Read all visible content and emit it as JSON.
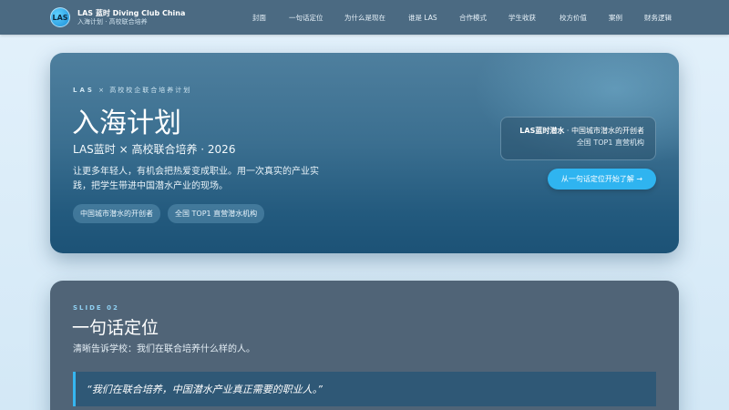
{
  "header": {
    "logo_text": "LAS",
    "brand_name": "LAS 蓝时 Diving Club China",
    "brand_sub": "入海计划 · 高校联合培养",
    "nav": [
      {
        "label": "封面"
      },
      {
        "label": "一句话定位"
      },
      {
        "label": "为什么是现在"
      },
      {
        "label": "谁是 LAS"
      },
      {
        "label": "合作模式"
      },
      {
        "label": "学生收获"
      },
      {
        "label": "校方价值"
      },
      {
        "label": "案例"
      },
      {
        "label": "财务逻辑"
      }
    ]
  },
  "hero": {
    "eyebrow_brand": "LAS",
    "eyebrow_text": "× 高校校企联合培养计划",
    "title": "入海计划",
    "subtitle": "LAS蓝时 × 高校联合培养 · 2026",
    "description": "让更多年轻人，有机会把热爱变成职业。用一次真实的产业实践，把学生带进中国潜水产业的现场。",
    "tags": [
      "中国城市潜水的开创者",
      "全国 TOP1 直营潜水机构"
    ],
    "info_brand": "LAS蓝时潜水",
    "info_line1_rest": " · 中国城市潜水的开创者",
    "info_line2": "全国 TOP1 直营机构",
    "cta": "从一句话定位开始了解 →"
  },
  "slide2": {
    "label": "SLIDE 02",
    "title": "一句话定位",
    "subtitle": "清晰告诉学校：我们在联合培养什么样的人。",
    "quote": "“我们在联合培养，中国潜水产业真正需要的职业人。”"
  },
  "colors": {
    "header_bg": "#4b6a82",
    "accent": "#2fb4f0",
    "hero_bg": "#2d6587",
    "slide2_bg": "#506477"
  }
}
